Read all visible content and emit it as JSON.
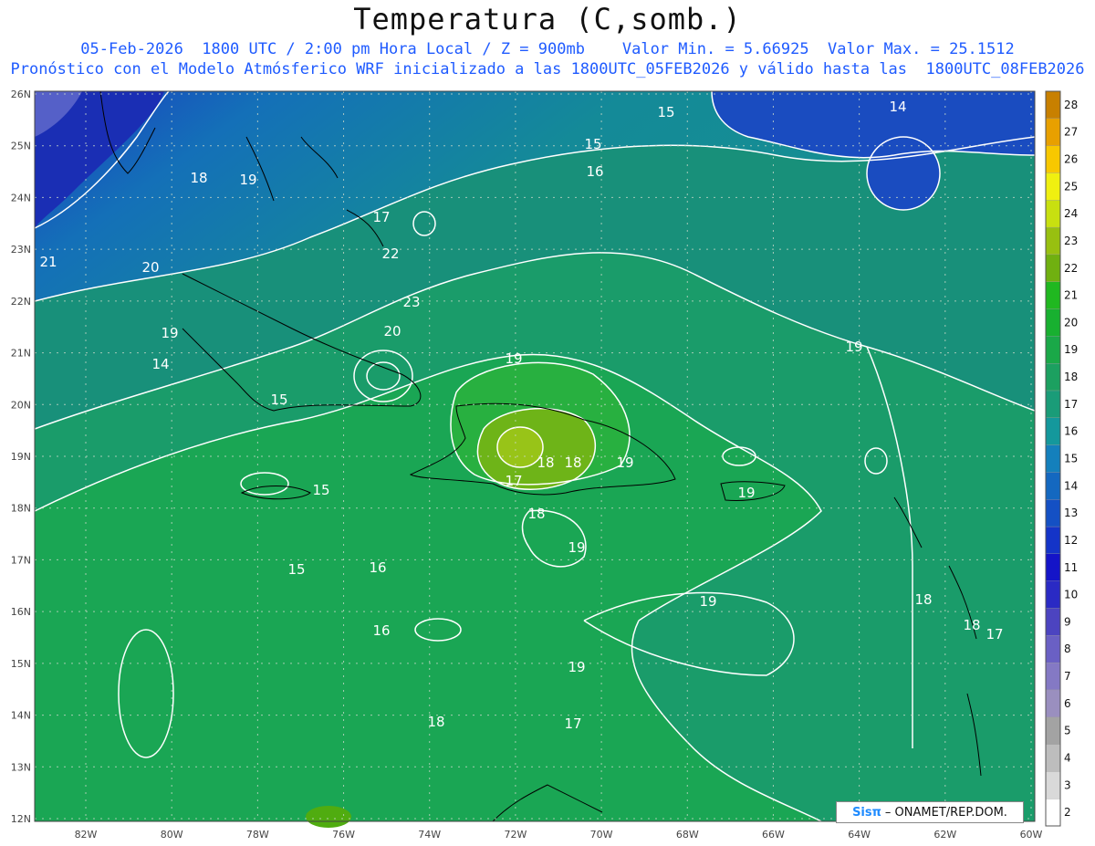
{
  "header": {
    "title": "Temperatura (C,somb.)",
    "line1": "05-Feb-2026  1800 UTC / 2:00 pm Hora Local / Z = 900mb    Valor Min. = 5.66925  Valor Max. = 25.1512",
    "line2": "Pronóstico con el Modelo Atmósferico WRF inicializado a las 1800UTC_05FEB2026 y válido hasta las  1800UTC_08FEB2026"
  },
  "axes": {
    "lat_labels": [
      "26N",
      "25N",
      "24N",
      "23N",
      "22N",
      "21N",
      "20N",
      "19N",
      "18N",
      "17N",
      "16N",
      "15N",
      "14N",
      "13N",
      "12N"
    ],
    "lon_labels": [
      "82W",
      "80W",
      "78W",
      "76W",
      "74W",
      "72W",
      "70W",
      "68W",
      "66W",
      "64W",
      "62W",
      "60W"
    ]
  },
  "colorbar": {
    "labels": [
      "2",
      "3",
      "4",
      "5",
      "6",
      "7",
      "8",
      "9",
      "10",
      "11",
      "12",
      "13",
      "14",
      "15",
      "16",
      "17",
      "18",
      "19",
      "20",
      "21",
      "22",
      "23",
      "24",
      "25",
      "26",
      "27",
      "28"
    ],
    "colors": [
      "#ffffff",
      "#d9d9d9",
      "#bdbdbd",
      "#a3a3a3",
      "#9a8fbf",
      "#8479c4",
      "#6a60c4",
      "#4c44c0",
      "#2a2ac4",
      "#1414c8",
      "#1434c8",
      "#1450c4",
      "#1468c0",
      "#1480bc",
      "#14989c",
      "#1a9c78",
      "#1ca060",
      "#1aa848",
      "#18b030",
      "#20b820",
      "#70b010",
      "#98c010",
      "#c8e010",
      "#f0f010",
      "#f8c800",
      "#e8a000",
      "#c88000"
    ]
  },
  "contour_labels": [
    "14",
    "15",
    "15",
    "16",
    "17",
    "18",
    "19",
    "20",
    "21",
    "22",
    "23",
    "20",
    "19",
    "18",
    "18",
    "17",
    "18",
    "19",
    "19",
    "19",
    "19",
    "19",
    "18",
    "17",
    "16",
    "15",
    "16",
    "15",
    "15",
    "14",
    "19",
    "18",
    "19",
    "18",
    "17"
  ],
  "credit": {
    "brand": "Sisπ",
    "text": "– ONAMET/REP.DOM."
  },
  "colors": {
    "title": "#111111",
    "subtitle": "#1f5bff",
    "contour": "#ffffff",
    "coast": "#000000"
  }
}
